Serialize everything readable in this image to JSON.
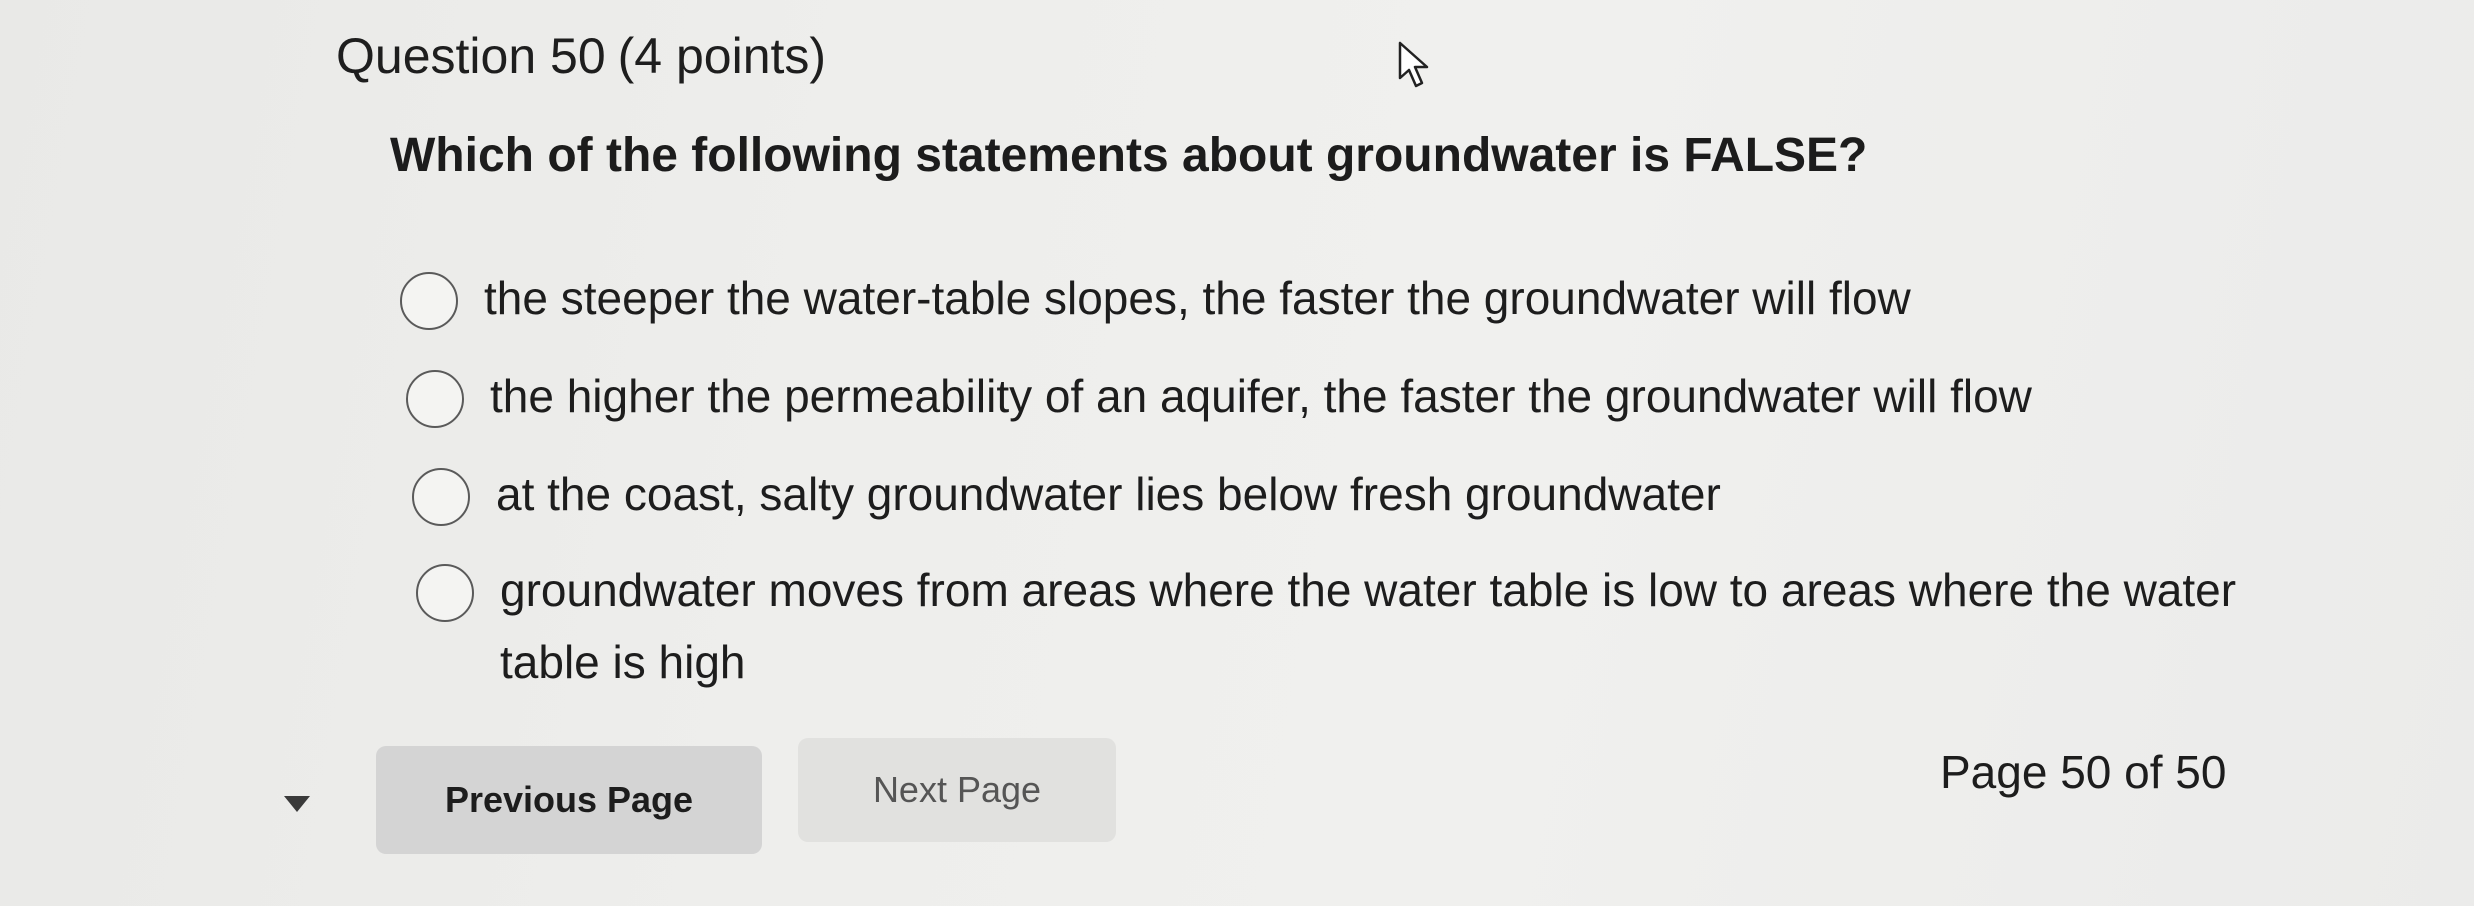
{
  "question": {
    "title": "Question 50",
    "points": "(4 points)",
    "prompt": "Which of the following statements about groundwater is FALSE?"
  },
  "options": [
    {
      "label": "the steeper the water-table slopes, the faster the groundwater will flow",
      "selected": false
    },
    {
      "label": "the higher the permeability of an aquifer, the faster the groundwater will flow",
      "selected": false
    },
    {
      "label": "at the coast, salty groundwater lies below fresh groundwater",
      "selected": false
    },
    {
      "label": "groundwater moves from areas where the water table is low to areas where the water table is high",
      "selected": false
    }
  ],
  "navigation": {
    "previous_label": "Previous Page",
    "next_label": "Next Page",
    "page_indicator": "Page 50 of 50"
  },
  "icons": {
    "cursor": "mouse-pointer-icon",
    "collapse": "caret-down-icon"
  }
}
